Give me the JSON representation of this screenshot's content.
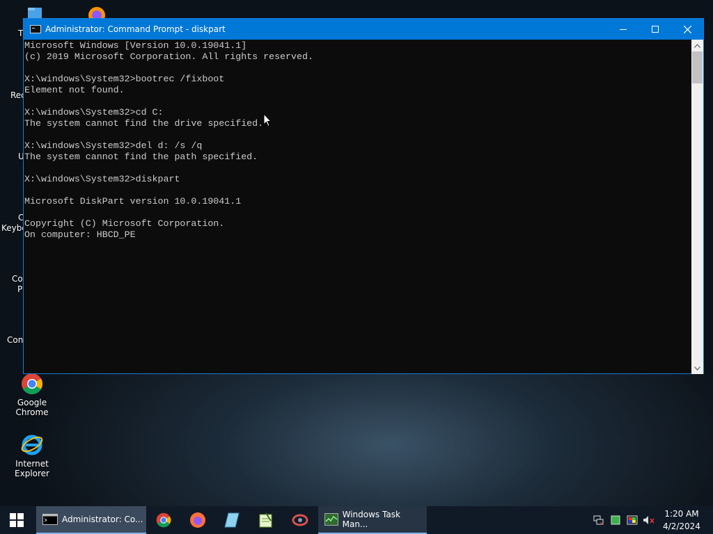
{
  "desktop": {
    "icons": [
      {
        "label": "Google Chrome"
      },
      {
        "label": "Internet Explorer"
      }
    ],
    "partial_labels": [
      "T",
      "Rec",
      "U",
      "C",
      "Keybo",
      "Co",
      "P",
      "Con"
    ]
  },
  "window": {
    "title": "Administrator: Command Prompt - diskpart",
    "console_lines": [
      "Microsoft Windows [Version 10.0.19041.1]",
      "(c) 2019 Microsoft Corporation. All rights reserved.",
      "",
      "X:\\windows\\System32>bootrec /fixboot",
      "Element not found.",
      "",
      "X:\\windows\\System32>cd C:",
      "The system cannot find the drive specified.",
      "",
      "X:\\windows\\System32>del d: /s /q",
      "The system cannot find the path specified.",
      "",
      "X:\\windows\\System32>diskpart",
      "",
      "Microsoft DiskPart version 10.0.19041.1",
      "",
      "Copyright (C) Microsoft Corporation.",
      "On computer: HBCD_PE"
    ]
  },
  "taskbar": {
    "active_item": "Administrator: Co...",
    "open_item": "Windows Task Man...",
    "clock_time": "1:20 AM",
    "clock_date": "4/2/2024"
  },
  "colors": {
    "accent": "#0078d7",
    "console_bg": "#0c0c0c",
    "console_fg": "#cccccc",
    "taskbar": "#101a26"
  }
}
